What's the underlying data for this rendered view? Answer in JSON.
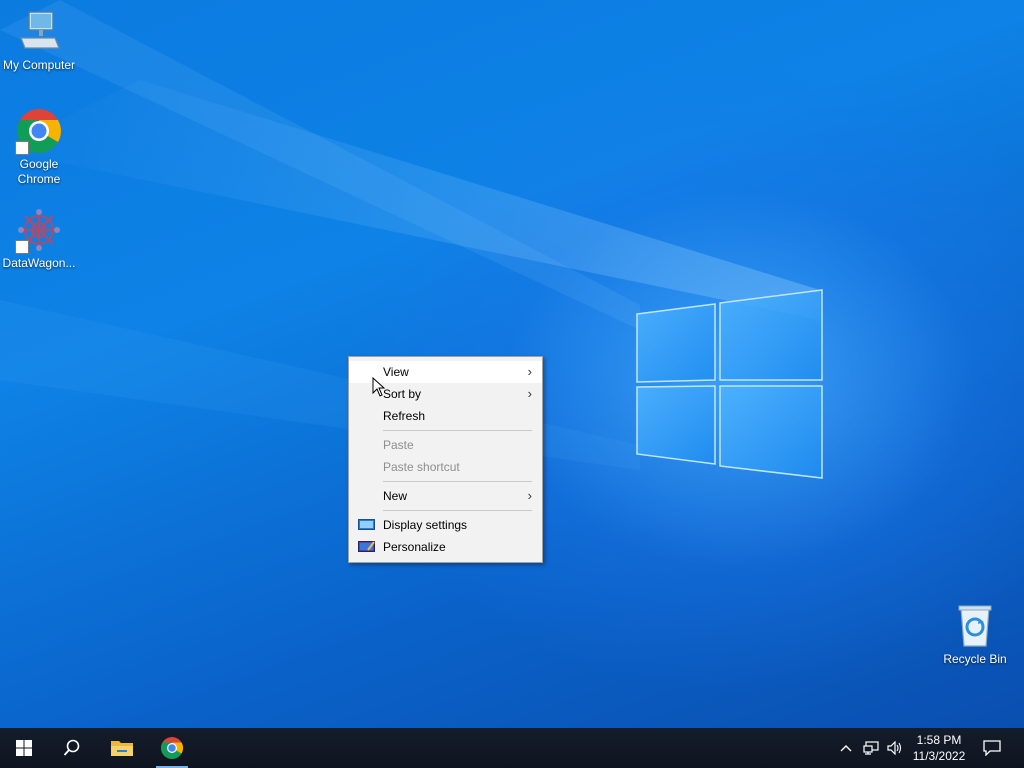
{
  "desktop": {
    "icons": [
      {
        "label": "My Computer",
        "icon": "computer-icon"
      },
      {
        "label": "Google\nChrome",
        "icon": "chrome-icon"
      },
      {
        "label": "DataWagon...",
        "icon": "datawagon-icon"
      },
      {
        "label": "Recycle Bin",
        "icon": "recycle-bin-icon"
      }
    ]
  },
  "context_menu": {
    "items": [
      {
        "label": "View",
        "has_submenu": true,
        "enabled": true
      },
      {
        "label": "Sort by",
        "has_submenu": true,
        "enabled": true
      },
      {
        "label": "Refresh",
        "has_submenu": false,
        "enabled": true
      },
      {
        "label": "Paste",
        "has_submenu": false,
        "enabled": false
      },
      {
        "label": "Paste shortcut",
        "has_submenu": false,
        "enabled": false
      },
      {
        "label": "New",
        "has_submenu": true,
        "enabled": true
      },
      {
        "label": "Display settings",
        "has_submenu": false,
        "enabled": true,
        "icon": "display-settings-icon"
      },
      {
        "label": "Personalize",
        "has_submenu": false,
        "enabled": true,
        "icon": "personalize-icon"
      }
    ],
    "submenu_glyph": "›"
  },
  "taskbar": {
    "buttons": [
      {
        "name": "start-button",
        "icon": "windows-logo-icon"
      },
      {
        "name": "search-button",
        "icon": "search-icon"
      },
      {
        "name": "file-explorer-button",
        "icon": "folder-icon"
      },
      {
        "name": "chrome-taskbar-button",
        "icon": "chrome-icon"
      }
    ],
    "tray": {
      "show_hidden_glyph": "^",
      "icons": [
        "chevron-up-icon",
        "network-icon",
        "volume-icon",
        "notification-icon"
      ]
    },
    "clock": {
      "time": "1:58 PM",
      "date": "11/3/2022"
    }
  },
  "colors": {
    "wallpaper": "#0a6fd6",
    "taskbar": "#101828",
    "menu_bg": "#f2f2f2",
    "menu_hover": "#ffffff",
    "disabled_text": "#8e8e8e"
  }
}
